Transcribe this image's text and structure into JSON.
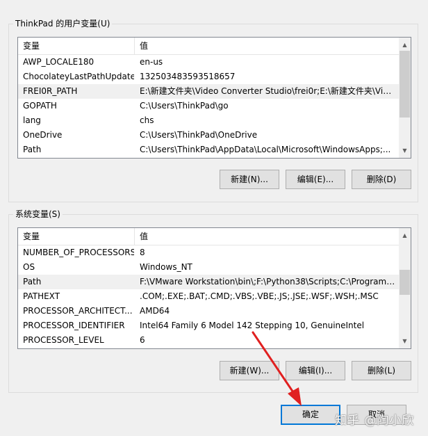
{
  "user_vars": {
    "title": "ThinkPad 的用户变量(U)",
    "col_name": "变量",
    "col_value": "值",
    "rows": [
      {
        "name": "AWP_LOCALE180",
        "value": "en-us"
      },
      {
        "name": "ChocolateyLastPathUpdate",
        "value": "132503483593518657"
      },
      {
        "name": "FREI0R_PATH",
        "value": "E:\\新建文件夹\\Video Converter Studio\\frei0r;E:\\新建文件夹\\Vid..."
      },
      {
        "name": "GOPATH",
        "value": "C:\\Users\\ThinkPad\\go"
      },
      {
        "name": "lang",
        "value": "chs"
      },
      {
        "name": "OneDrive",
        "value": "C:\\Users\\ThinkPad\\OneDrive"
      },
      {
        "name": "Path",
        "value": "C:\\Users\\ThinkPad\\AppData\\Local\\Microsoft\\WindowsApps;..."
      }
    ],
    "selected_index": 2,
    "new_label": "新建(N)...",
    "edit_label": "编辑(E)...",
    "delete_label": "删除(D)"
  },
  "system_vars": {
    "title": "系统变量(S)",
    "col_name": "变量",
    "col_value": "值",
    "rows": [
      {
        "name": "NUMBER_OF_PROCESSORS",
        "value": "8"
      },
      {
        "name": "OS",
        "value": "Windows_NT"
      },
      {
        "name": "Path",
        "value": "F:\\VMware Workstation\\bin\\;F:\\Python38\\Scripts;C:\\Program ..."
      },
      {
        "name": "PATHEXT",
        "value": ".COM;.EXE;.BAT;.CMD;.VBS;.VBE;.JS;.JSE;.WSF;.WSH;.MSC"
      },
      {
        "name": "PROCESSOR_ARCHITECT...",
        "value": "AMD64"
      },
      {
        "name": "PROCESSOR_IDENTIFIER",
        "value": "Intel64 Family 6 Model 142 Stepping 10, GenuineIntel"
      },
      {
        "name": "PROCESSOR_LEVEL",
        "value": "6"
      }
    ],
    "selected_index": 2,
    "new_label": "新建(W)...",
    "edit_label": "编辑(I)...",
    "delete_label": "删除(L)"
  },
  "footer": {
    "ok_label": "确定",
    "cancel_label": "取消"
  },
  "watermark": "知乎 @陶小欣",
  "colors": {
    "default_button_border": "#0078d7",
    "annotation_arrow": "#e02020"
  }
}
